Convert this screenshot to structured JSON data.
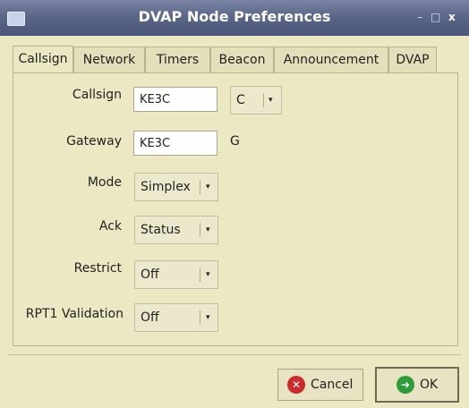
{
  "window": {
    "title": "DVAP Node Preferences",
    "controls": {
      "minimize": "–",
      "maximize": "□",
      "close": "x"
    }
  },
  "tabs": [
    {
      "label": "Callsign",
      "active": true
    },
    {
      "label": "Network",
      "active": false
    },
    {
      "label": "Timers",
      "active": false
    },
    {
      "label": "Beacon",
      "active": false
    },
    {
      "label": "Announcement",
      "active": false
    },
    {
      "label": "DVAP",
      "active": false
    }
  ],
  "form": {
    "callsign": {
      "label": "Callsign",
      "value": "KE3C",
      "suffix": "C"
    },
    "gateway": {
      "label": "Gateway",
      "value": "KE3C",
      "suffix": "G"
    },
    "mode": {
      "label": "Mode",
      "value": "Simplex"
    },
    "ack": {
      "label": "Ack",
      "value": "Status"
    },
    "restrict": {
      "label": "Restrict",
      "value": "Off"
    },
    "rpt1_validation": {
      "label": "RPT1 Validation",
      "value": "Off"
    }
  },
  "buttons": {
    "cancel": "Cancel",
    "ok": "OK"
  },
  "colors": {
    "titlebar": "#5b6789",
    "background": "#ede8c4",
    "cancel_icon": "#cc2b2b",
    "ok_icon": "#2e9a3a"
  }
}
